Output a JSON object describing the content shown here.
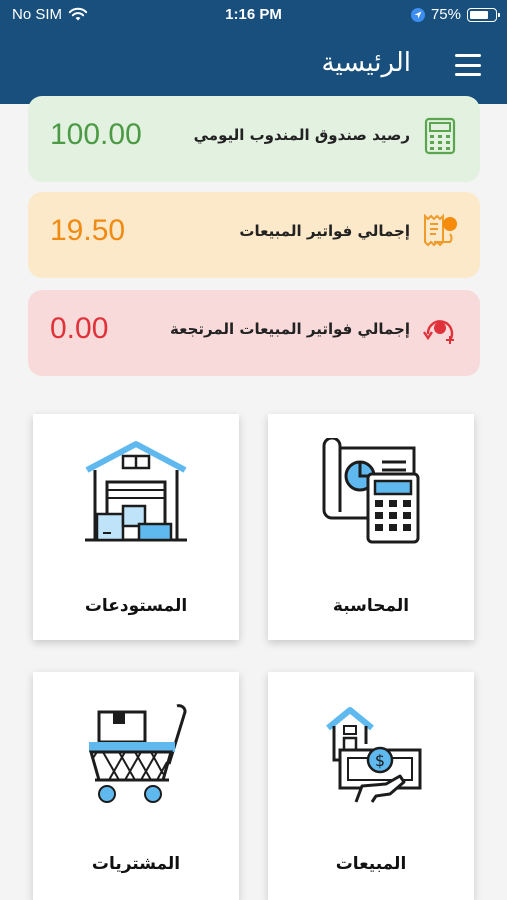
{
  "status_bar": {
    "carrier": "No SIM",
    "time": "1:16 PM",
    "battery": "75%",
    "battery_level": 0.75
  },
  "header": {
    "title": "الرئيسية",
    "menu_icon": "hamburger-menu-icon"
  },
  "summary_cards": [
    {
      "label": "رصيد صندوق المندوب اليومي",
      "value": "100.00",
      "icon": "calculator-icon",
      "color": "#4c9a45"
    },
    {
      "label": "إجمالي فواتير المبيعات",
      "value": "19.50",
      "icon": "receipt-icon",
      "color": "#f08a12"
    },
    {
      "label": "إجمالي فواتير المبيعات المرتجعة",
      "value": "0.00",
      "icon": "return-icon",
      "color": "#e0323a"
    }
  ],
  "tiles": [
    {
      "label": "المحاسبة",
      "icon": "accounting-icon"
    },
    {
      "label": "المستودعات",
      "icon": "warehouse-icon"
    },
    {
      "label": "المبيعات",
      "icon": "sales-icon"
    },
    {
      "label": "المشتريات",
      "icon": "purchases-icon"
    }
  ]
}
